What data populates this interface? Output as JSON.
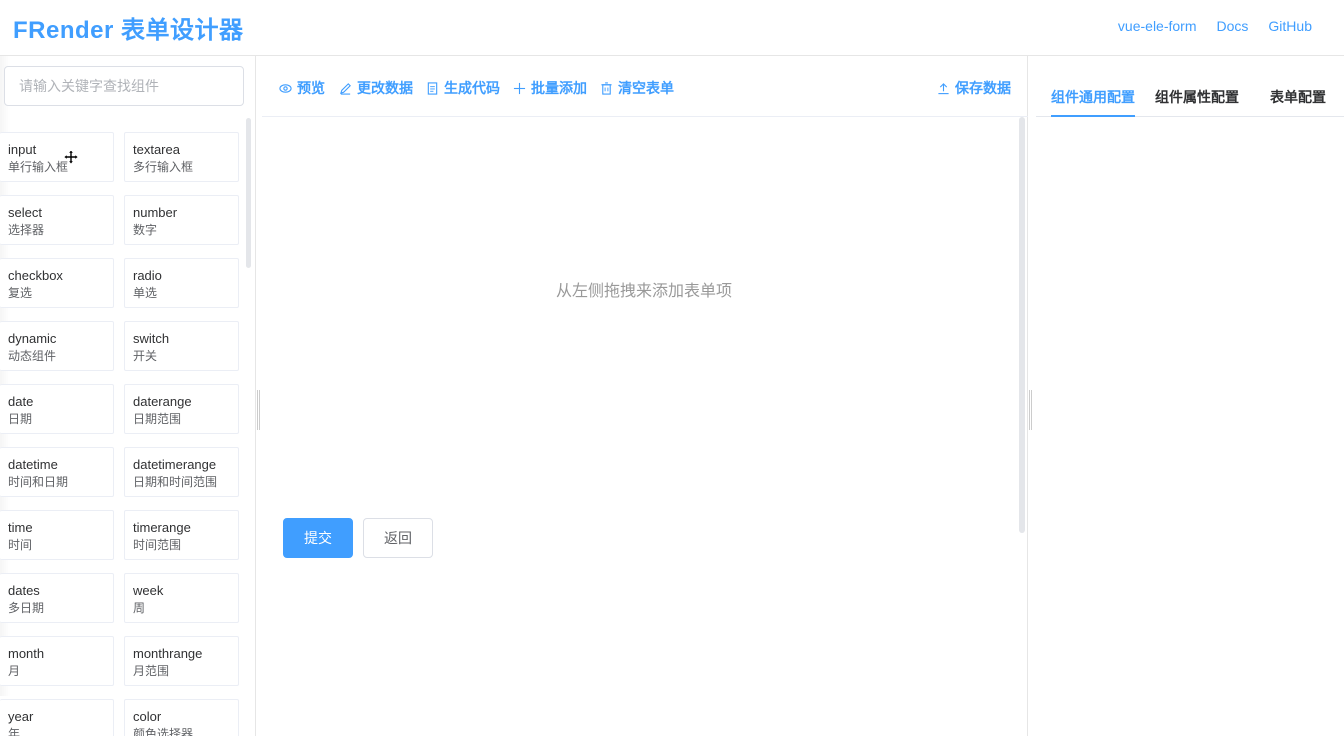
{
  "header": {
    "logo": "FRender 表单设计器",
    "links": [
      "vue-ele-form",
      "Docs",
      "GitHub"
    ]
  },
  "left": {
    "search_placeholder": "请输入关键字查找组件",
    "components": [
      {
        "en": "input",
        "cn": "单行输入框"
      },
      {
        "en": "textarea",
        "cn": "多行输入框"
      },
      {
        "en": "select",
        "cn": "选择器"
      },
      {
        "en": "number",
        "cn": "数字"
      },
      {
        "en": "checkbox",
        "cn": "复选"
      },
      {
        "en": "radio",
        "cn": "单选"
      },
      {
        "en": "dynamic",
        "cn": "动态组件"
      },
      {
        "en": "switch",
        "cn": "开关"
      },
      {
        "en": "date",
        "cn": "日期"
      },
      {
        "en": "daterange",
        "cn": "日期范围"
      },
      {
        "en": "datetime",
        "cn": "时间和日期"
      },
      {
        "en": "datetimerange",
        "cn": "日期和时间范围"
      },
      {
        "en": "time",
        "cn": "时间"
      },
      {
        "en": "timerange",
        "cn": "时间范围"
      },
      {
        "en": "dates",
        "cn": "多日期"
      },
      {
        "en": "week",
        "cn": "周"
      },
      {
        "en": "month",
        "cn": "月"
      },
      {
        "en": "monthrange",
        "cn": "月范围"
      },
      {
        "en": "year",
        "cn": "年"
      },
      {
        "en": "color",
        "cn": "颜色选择器"
      }
    ]
  },
  "toolbar": {
    "preview": "预览",
    "edit_data": "更改数据",
    "gen_code": "生成代码",
    "batch_add": "批量添加",
    "clear_form": "清空表单",
    "save_data": "保存数据"
  },
  "canvas": {
    "empty_tip": "从左侧拖拽来添加表单项",
    "submit": "提交",
    "back": "返回"
  },
  "right": {
    "tabs": [
      "组件通用配置",
      "组件属性配置",
      "表单配置"
    ],
    "active_tab": 0
  },
  "colors": {
    "accent": "#409eff",
    "border": "#e6e6e6"
  }
}
